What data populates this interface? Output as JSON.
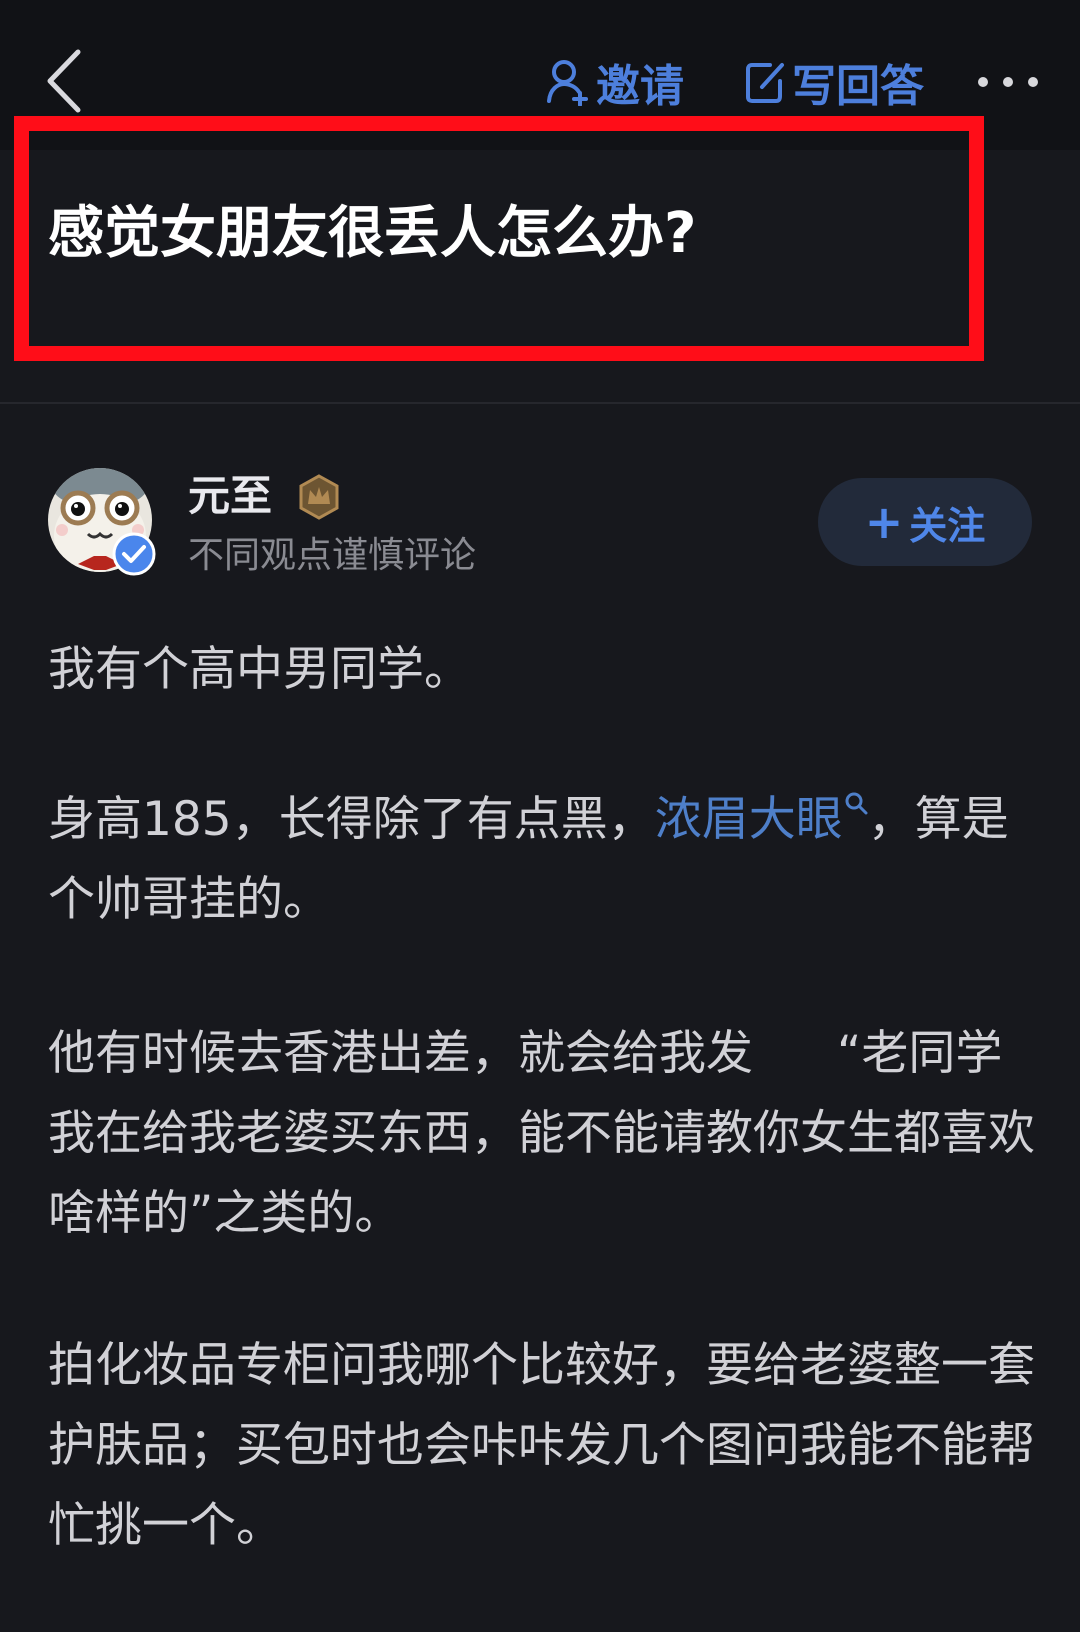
{
  "toolbar": {
    "invite_label": "邀请",
    "write_label": "写回答",
    "back_icon": "chevron-left-icon",
    "more_icon": "more-dots-icon",
    "accent_color": "#4d7fdc"
  },
  "question": {
    "title": "感觉女朋友很丢人怎么办?"
  },
  "author": {
    "name": "元至",
    "subtitle": "不同观点谨慎评论",
    "follow_label": "关注",
    "avatar_icon": "cartoon-avatar-icon",
    "verified_icon": "verified-check-icon",
    "badge_icon": "crown-badge-icon"
  },
  "answer": {
    "p1": "我有个高中男同学。",
    "p2_before": "身高185，长得除了有点黑，",
    "p2_link": "浓眉大眼",
    "p2_after": "，算是个帅哥挂的。",
    "p3_before": "他有时候去香港出差，就会给我发",
    "p3_after": "“老同学我在给我老婆买东西，能不能请教你女生都喜欢啥样的”之类的。",
    "p4": "拍化妆品专柜问我哪个比较好，要给老婆整一套护肤品；买包时也会咔咔发几个图问我能不能帮忙挑一个。"
  }
}
